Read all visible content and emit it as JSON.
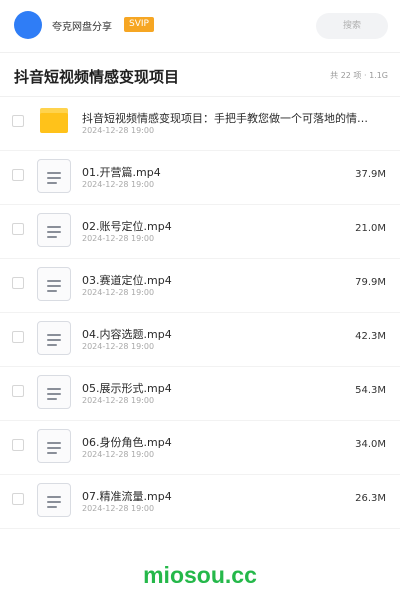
{
  "header": {
    "share_name": "夸克网盘分享",
    "badge": "SVIP",
    "search_placeholder": "搜索"
  },
  "title_bar": {
    "title": "抖音短视频情感变现项目",
    "summary": "共 22 项 · 1.1G"
  },
  "items": [
    {
      "type": "folder",
      "icon": "folder-icon",
      "name": "抖音短视频情感变现项目：手把手教您做一个可落地的情…",
      "date": "2024-12-28 19:00",
      "size": ""
    },
    {
      "type": "file",
      "icon": "file-icon",
      "name": "01.开营篇.mp4",
      "date": "2024-12-28 19:00",
      "size": "37.9M"
    },
    {
      "type": "file",
      "icon": "file-icon",
      "name": "02.账号定位.mp4",
      "date": "2024-12-28 19:00",
      "size": "21.0M"
    },
    {
      "type": "file",
      "icon": "file-icon",
      "name": "03.赛道定位.mp4",
      "date": "2024-12-28 19:00",
      "size": "79.9M"
    },
    {
      "type": "file",
      "icon": "file-icon",
      "name": "04.内容选题.mp4",
      "date": "2024-12-28 19:00",
      "size": "42.3M"
    },
    {
      "type": "file",
      "icon": "file-icon",
      "name": "05.展示形式.mp4",
      "date": "2024-12-28 19:00",
      "size": "54.3M"
    },
    {
      "type": "file",
      "icon": "file-icon",
      "name": "06.身份角色.mp4",
      "date": "2024-12-28 19:00",
      "size": "34.0M"
    },
    {
      "type": "file",
      "icon": "file-icon",
      "name": "07.精准流量.mp4",
      "date": "2024-12-28 19:00",
      "size": "26.3M"
    }
  ],
  "watermark": "miosou.cc",
  "colors": {
    "avatar": "#2f7df6",
    "badge": "#f6a623",
    "folder": "#ffc21a",
    "watermark": "#25b84a"
  }
}
